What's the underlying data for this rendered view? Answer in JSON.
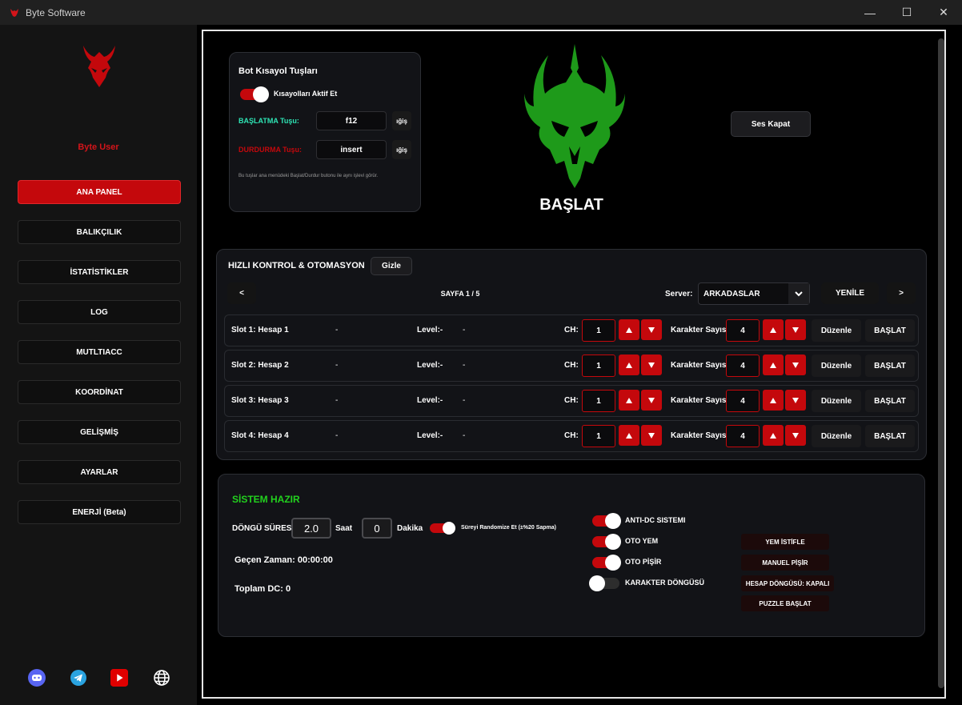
{
  "window": {
    "title": "Byte Software",
    "minimize": "—",
    "maximize": "☐",
    "close": "✕"
  },
  "sidebar": {
    "user": "Byte User",
    "items": [
      {
        "label": "ANA PANEL"
      },
      {
        "label": "BALIKÇILIK"
      },
      {
        "label": "İSTATİSTİKLER"
      },
      {
        "label": "LOG"
      },
      {
        "label": "MUTLTIACC"
      },
      {
        "label": "KOORDİNAT"
      },
      {
        "label": "GELİŞMİŞ"
      },
      {
        "label": "AYARLAR"
      },
      {
        "label": "ENERJİ (Beta)"
      }
    ],
    "active": "ANA PANEL"
  },
  "shortcuts": {
    "title": "Bot Kısayol Tuşları",
    "toggle_label": "Kısayolları Aktif Et",
    "start_label": "BAŞLATMA Tuşu:",
    "start_key": "f12",
    "stop_label": "DURDURMA Tuşu:",
    "stop_key": "insert",
    "change": "ığiş",
    "note": "Bu tuşlar ana menüdeki Başlat/Durdur butonu ile aynı işlevi görür.",
    "start_color": "#2ee5b5",
    "stop_color": "#c4080c"
  },
  "hero": {
    "start": "BAŞLAT",
    "mute": "Ses Kapat",
    "logo_color": "#1e9a1a"
  },
  "quick": {
    "title": "HIZLI KONTROL & OTOMASYON",
    "hide": "Gizle",
    "prev": "<",
    "next": ">",
    "page": "SAYFA 1 / 5",
    "server_label": "Server:",
    "server_value": "ARKADASLAR",
    "refresh": "YENİLE",
    "slots": [
      {
        "name": "Slot 1: Hesap 1",
        "dash1": "-",
        "level": "Level:-",
        "dash2": "-",
        "ch_label": "CH:",
        "ch": "1",
        "char_label": "Karakter Sayısı:",
        "chars": "4",
        "edit": "Düzenle",
        "start": "BAŞLAT"
      },
      {
        "name": "Slot 2: Hesap 2",
        "dash1": "-",
        "level": "Level:-",
        "dash2": "-",
        "ch_label": "CH:",
        "ch": "1",
        "char_label": "Karakter Sayısı:",
        "chars": "4",
        "edit": "Düzenle",
        "start": "BAŞLAT"
      },
      {
        "name": "Slot 3: Hesap 3",
        "dash1": "-",
        "level": "Level:-",
        "dash2": "-",
        "ch_label": "CH:",
        "ch": "1",
        "char_label": "Karakter Sayısı:",
        "chars": "4",
        "edit": "Düzenle",
        "start": "BAŞLAT"
      },
      {
        "name": "Slot 4: Hesap 4",
        "dash1": "-",
        "level": "Level:-",
        "dash2": "-",
        "ch_label": "CH:",
        "ch": "1",
        "char_label": "Karakter Sayısı:",
        "chars": "4",
        "edit": "Düzenle",
        "start": "BAŞLAT"
      }
    ]
  },
  "system": {
    "status": "SİSTEM HAZIR",
    "status_color": "#22d11e",
    "cycle_label": "DÖNGÜ SÜRESİ:",
    "hours": "2.0",
    "hours_label": "Saat",
    "minutes": "0",
    "minutes_label": "Dakika",
    "randomize": "Süreyi Randomize Et (±%20 Sapma)",
    "elapsed": "Geçen Zaman: 00:00:00",
    "total_dc": "Toplam DC: 0",
    "toggles": [
      {
        "label": "ANTI-DC SISTEMI",
        "on": true
      },
      {
        "label": "OTO YEM",
        "on": true
      },
      {
        "label": "OTO PİŞİR",
        "on": true
      },
      {
        "label": "KARAKTER DÖNGÜSÜ",
        "on": false
      }
    ],
    "buttons": [
      "YEM İSTİFLE",
      "MANUEL PİŞİR",
      "HESAP DÖNGÜSÜ: KAPALI",
      "PUZZLE BAŞLAT"
    ]
  }
}
